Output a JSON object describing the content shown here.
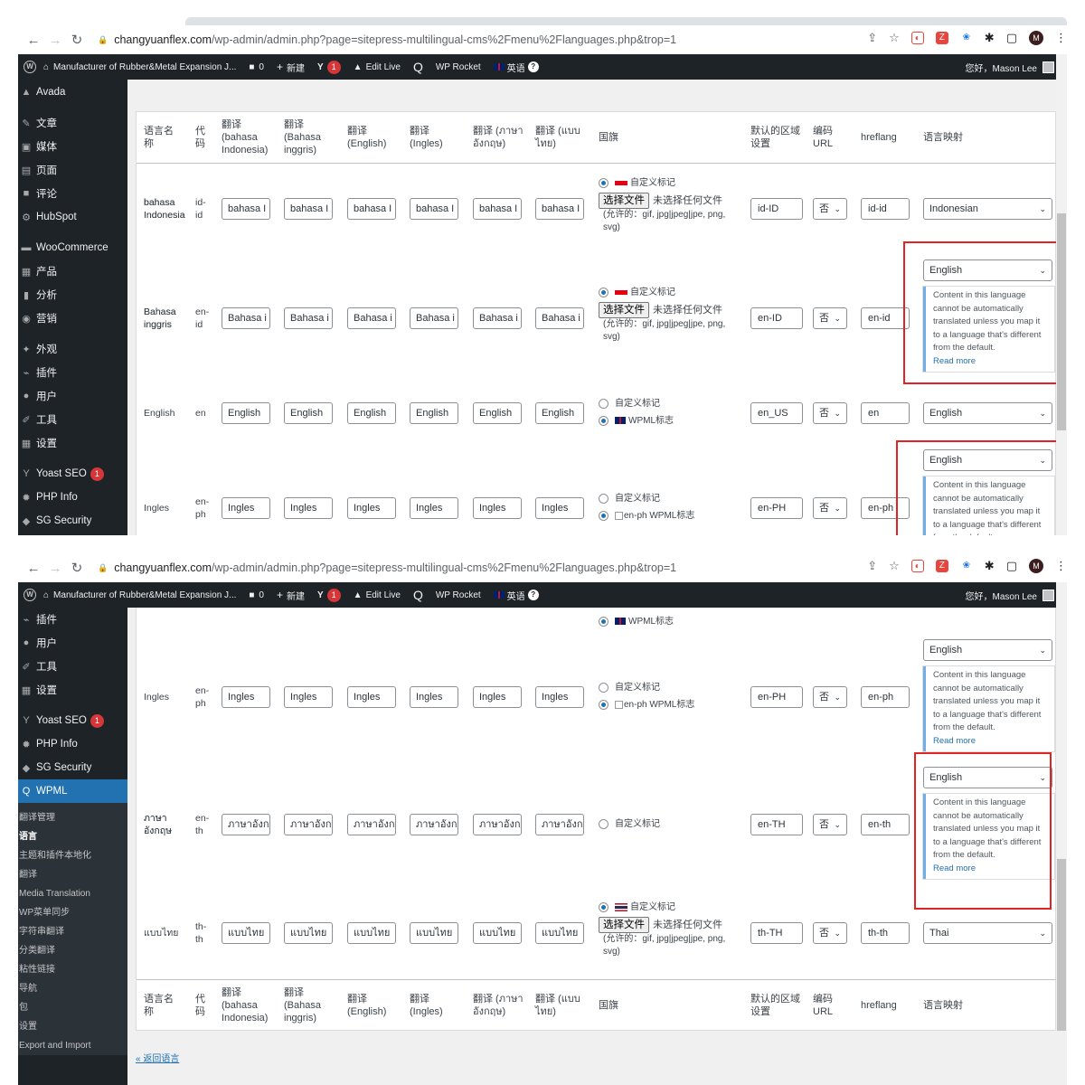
{
  "browser": {
    "url_host": "changyuanflex.com",
    "url_path": "/wp-admin/admin.php?page=sitepress-multilingual-cms%2Fmenu%2Flanguages.php&trop=1",
    "avatar_letter": "M"
  },
  "adminbar": {
    "site_name": "Manufacturer of Rubber&Metal Expansion J...",
    "comments_count": "0",
    "new_label": "新建",
    "yoast_badge": "1",
    "edit_live": "Edit Live",
    "wp_rocket": "WP Rocket",
    "language_label": "英语",
    "greeting": "您好，Mason Lee"
  },
  "sidebar1": {
    "items": [
      {
        "icon": "avada-icon",
        "label": "Avada"
      },
      {
        "icon": "pin-icon",
        "label": "文章"
      },
      {
        "icon": "media-icon",
        "label": "媒体"
      },
      {
        "icon": "page-icon",
        "label": "页面"
      },
      {
        "icon": "comment-icon",
        "label": "评论"
      },
      {
        "icon": "hubspot-icon",
        "label": "HubSpot"
      },
      {
        "icon": "woo-icon",
        "label": "WooCommerce"
      },
      {
        "icon": "product-icon",
        "label": "产品"
      },
      {
        "icon": "analytics-icon",
        "label": "分析"
      },
      {
        "icon": "marketing-icon",
        "label": "营销"
      },
      {
        "icon": "appearance-icon",
        "label": "外观"
      },
      {
        "icon": "plugin-icon",
        "label": "插件"
      },
      {
        "icon": "user-icon",
        "label": "用户"
      },
      {
        "icon": "tool-icon",
        "label": "工具"
      },
      {
        "icon": "settings-icon",
        "label": "设置"
      },
      {
        "icon": "yoast-icon",
        "label": "Yoast SEO",
        "badge": "1"
      },
      {
        "icon": "gear-icon",
        "label": "PHP Info"
      },
      {
        "icon": "security-icon",
        "label": "SG Security"
      }
    ]
  },
  "sidebar2": {
    "items": [
      {
        "icon": "plugin-icon",
        "label": "插件"
      },
      {
        "icon": "user-icon",
        "label": "用户"
      },
      {
        "icon": "tool-icon",
        "label": "工具"
      },
      {
        "icon": "settings-icon",
        "label": "设置"
      },
      {
        "icon": "yoast-icon",
        "label": "Yoast SEO",
        "badge": "1"
      },
      {
        "icon": "gear-icon",
        "label": "PHP Info"
      },
      {
        "icon": "security-icon",
        "label": "SG Security"
      },
      {
        "icon": "wpml-icon",
        "label": "WPML",
        "current": true
      }
    ],
    "submenu": [
      "翻译管理",
      "语言",
      "主题和插件本地化",
      "翻译",
      "Media Translation",
      "WP菜单同步",
      "字符串翻译",
      "分类翻译",
      "粘性链接",
      "导航",
      "包",
      "设置",
      "Export and Import"
    ],
    "submenu_current": "语言"
  },
  "table": {
    "headers": {
      "name": "语言名称",
      "code": "代码",
      "t1": "翻译 (bahasa Indonesia)",
      "t2": "翻译 (Bahasa inggris)",
      "t3": "翻译 (English)",
      "t4": "翻译 (Ingles)",
      "t5": "翻译 (ภาษาอังกฤษ)",
      "t6": "翻译 (แบบไทย)",
      "flag": "国旗",
      "locale": "默认的区域设置",
      "encode": "编码 URL",
      "hreflang": "hreflang",
      "mapping": "语言映射"
    },
    "labels": {
      "custom_flag": "自定义标记",
      "choose_file": "选择文件",
      "no_file": "未选择任何文件",
      "allowed": "(允许的：gif, jpg|jpeg|jpe, png, svg)",
      "wpml_flag": "WPML标志",
      "no": "否",
      "note_text": "Content in this language cannot be automatically translated unless you map it to a language that's different from the default.",
      "read_more": "Read more",
      "back_link": "« 返回语言"
    },
    "rows": {
      "id": {
        "name": "bahasa Indonesia",
        "code": "id-id",
        "t": "bahasa I",
        "locale": "id-ID",
        "hreflang": "id-id",
        "mapping": "Indonesian"
      },
      "inggris": {
        "name": "Bahasa inggris",
        "code": "en-id",
        "t": "Bahasa i",
        "locale": "en-ID",
        "hreflang": "en-id",
        "mapping": "English"
      },
      "en": {
        "name": "English",
        "code": "en",
        "t": "English",
        "locale": "en_US",
        "hreflang": "en",
        "mapping": "English"
      },
      "ingles": {
        "name": "Ingles",
        "code": "en-ph",
        "t": "Ingles",
        "locale": "en-PH",
        "hreflang": "en-ph",
        "mapping": "English",
        "flag_alt": "en-ph"
      },
      "th_en": {
        "name": "ภาษาอังกฤษ",
        "code": "en-th",
        "t": "ภาษาอังก",
        "locale": "en-TH",
        "hreflang": "en-th",
        "mapping": "English"
      },
      "th": {
        "name": "แบบไทย",
        "code": "th-th",
        "t": "แบบไทย",
        "locale": "th-TH",
        "hreflang": "th-th",
        "mapping": "Thai"
      }
    }
  }
}
